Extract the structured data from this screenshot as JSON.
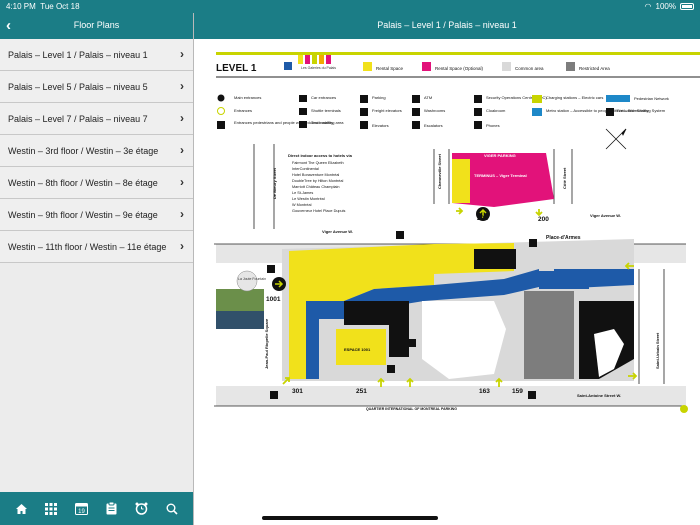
{
  "status": {
    "time": "4:10 PM",
    "date": "Tue Oct 18",
    "battery": "100%"
  },
  "sidebar": {
    "title": "Floor Plans",
    "items": [
      {
        "label": "Palais – Level 1 / Palais – niveau 1"
      },
      {
        "label": "Palais – Level 5 / Palais – niveau 5"
      },
      {
        "label": "Palais – Level 7 / Palais – niveau 7"
      },
      {
        "label": "Westin – 3rd floor / Westin – 3e étage"
      },
      {
        "label": "Westin – 8th floor / Westin – 8e étage"
      },
      {
        "label": "Westin – 9th floor / Westin – 9e étage"
      },
      {
        "label": "Westin – 11th floor / Westin – 11e étage"
      }
    ]
  },
  "tabbar": {
    "calendar_day": "19"
  },
  "main": {
    "title": "Palais – Level 1 / Palais – niveau 1"
  },
  "map": {
    "level": "LEVEL 1",
    "brand": "Les Galeries du Palais",
    "legend_top": {
      "rental": "Rental Space",
      "rental_optional": "Rental Space (Optional)",
      "common": "Common area",
      "restricted": "Restricted Area"
    },
    "legend": {
      "main_entrances": "Main entrances",
      "entrances": "Entrances",
      "ped_reduced": "Entrances pedestrians and people with reduced mobility",
      "car_entrances": "Car entrances",
      "shuttle": "Shuttle terminals",
      "truck": "Truck waiting area",
      "parking": "Parking",
      "freight": "Freight elevators",
      "elevators": "Elevators",
      "atm": "ATM",
      "washrooms": "Washrooms",
      "escalators": "Escalators",
      "security": "Security Operations Centre (SOC)",
      "cloakroom": "Cloakroom",
      "phones": "Phones",
      "charging": "Charging stations – Electric cars",
      "metro": "Metro station – Accessible to people with reduced mobility",
      "ped_network": "Pedestrian Network",
      "bixi": "Bixi – Bike Sharing System"
    },
    "hotels": {
      "heading": "Direct indoor access to hotels via",
      "list": [
        "Fairmont The Queen Elizabeth",
        "InterContinental",
        "Hotel Bonaventure Montréal",
        "DoubleTree by Hilton Montréal",
        "Marriott Château Champlain",
        "Le St-James",
        "Le Westin Montréal",
        "W Montréal",
        "Gouverneur Hotel Place Dupuis"
      ]
    },
    "streets": {
      "de_bleury": "De Bleury Street",
      "viger_w": "Viger Avenue W.",
      "viger_w_right": "Viger Avenue W.",
      "chenneville": "Chenneville Street",
      "cote": "Côté Street",
      "jean_paul": "Jean-Paul Riopelle Square",
      "saint_urbain": "Saint-Urbain Street",
      "saint_antoine": "Saint-Antoine Street W.",
      "quartier": "QUARTIER INTERNATIONAL OF MONTREAL PARKING"
    },
    "places": {
      "fountain": "La Joute Fountain",
      "place_armes": "Place-d'Armes",
      "espace": "ESPACE 1001",
      "viger_parking": "VIGER PARKING",
      "terminus": "TERMINUS – Viger Terminal"
    },
    "doors": [
      "1001",
      "201",
      "200",
      "301",
      "251",
      "163",
      "159"
    ]
  }
}
